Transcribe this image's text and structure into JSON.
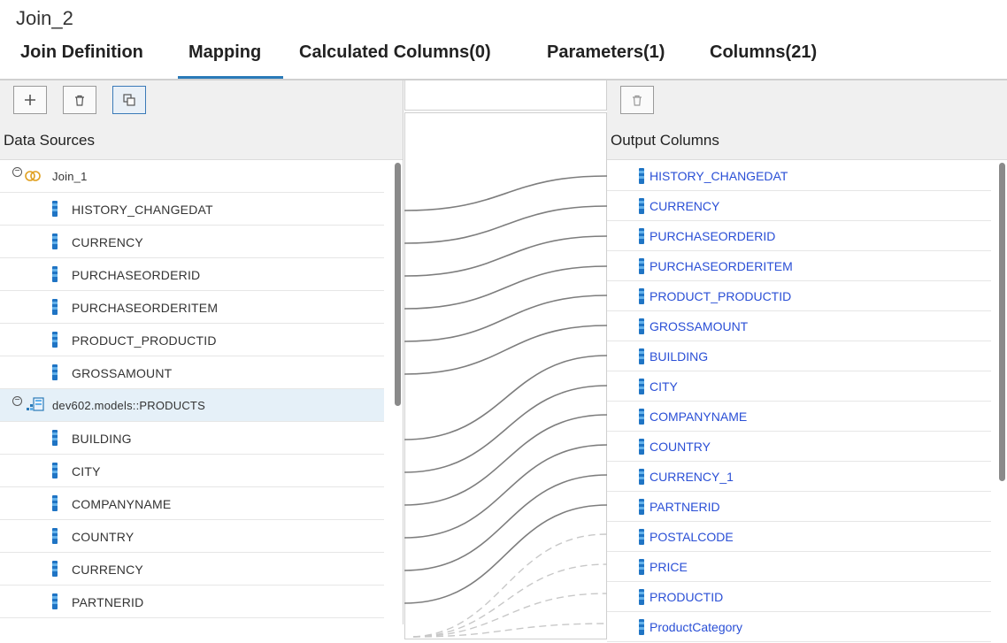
{
  "window": {
    "title": "Join_2"
  },
  "tabs": [
    {
      "label": "Join Definition"
    },
    {
      "label": "Mapping"
    },
    {
      "label": "Calculated Columns(0)"
    },
    {
      "label": "Parameters(1)"
    },
    {
      "label": "Columns(21)"
    }
  ],
  "active_tab": "Mapping",
  "left_panel": {
    "toolbar": {
      "add_icon": "plus-icon",
      "delete_icon": "trash-icon",
      "copy_icon": "copy-icon"
    },
    "header": "Data Sources",
    "groups": [
      {
        "name": "Join_1",
        "icon": "join-icon",
        "columns": [
          "HISTORY_CHANGEDAT",
          "CURRENCY",
          "PURCHASEORDERID",
          "PURCHASEORDERITEM",
          "PRODUCT_PRODUCTID",
          "GROSSAMOUNT"
        ]
      },
      {
        "name": "dev602.models::PRODUCTS",
        "icon": "table-icon",
        "columns": [
          "BUILDING",
          "CITY",
          "COMPANYNAME",
          "COUNTRY",
          "CURRENCY",
          "PARTNERID"
        ]
      }
    ]
  },
  "right_panel": {
    "toolbar": {
      "delete_icon": "trash-icon"
    },
    "header": "Output Columns",
    "columns": [
      "HISTORY_CHANGEDAT",
      "CURRENCY",
      "PURCHASEORDERID",
      "PURCHASEORDERITEM",
      "PRODUCT_PRODUCTID",
      "GROSSAMOUNT",
      "BUILDING",
      "CITY",
      "COMPANYNAME",
      "COUNTRY",
      "CURRENCY_1",
      "PARTNERID",
      "POSTALCODE",
      "PRICE",
      "PRODUCTID",
      "ProductCategory"
    ]
  },
  "colors": {
    "tab_accent": "#2a7ab8",
    "output_text": "#2a4fd6",
    "selected_row": "#e5f0f8",
    "mapping_line": "#7d7d7d",
    "mapping_line_hidden": "#c8c8c8"
  }
}
